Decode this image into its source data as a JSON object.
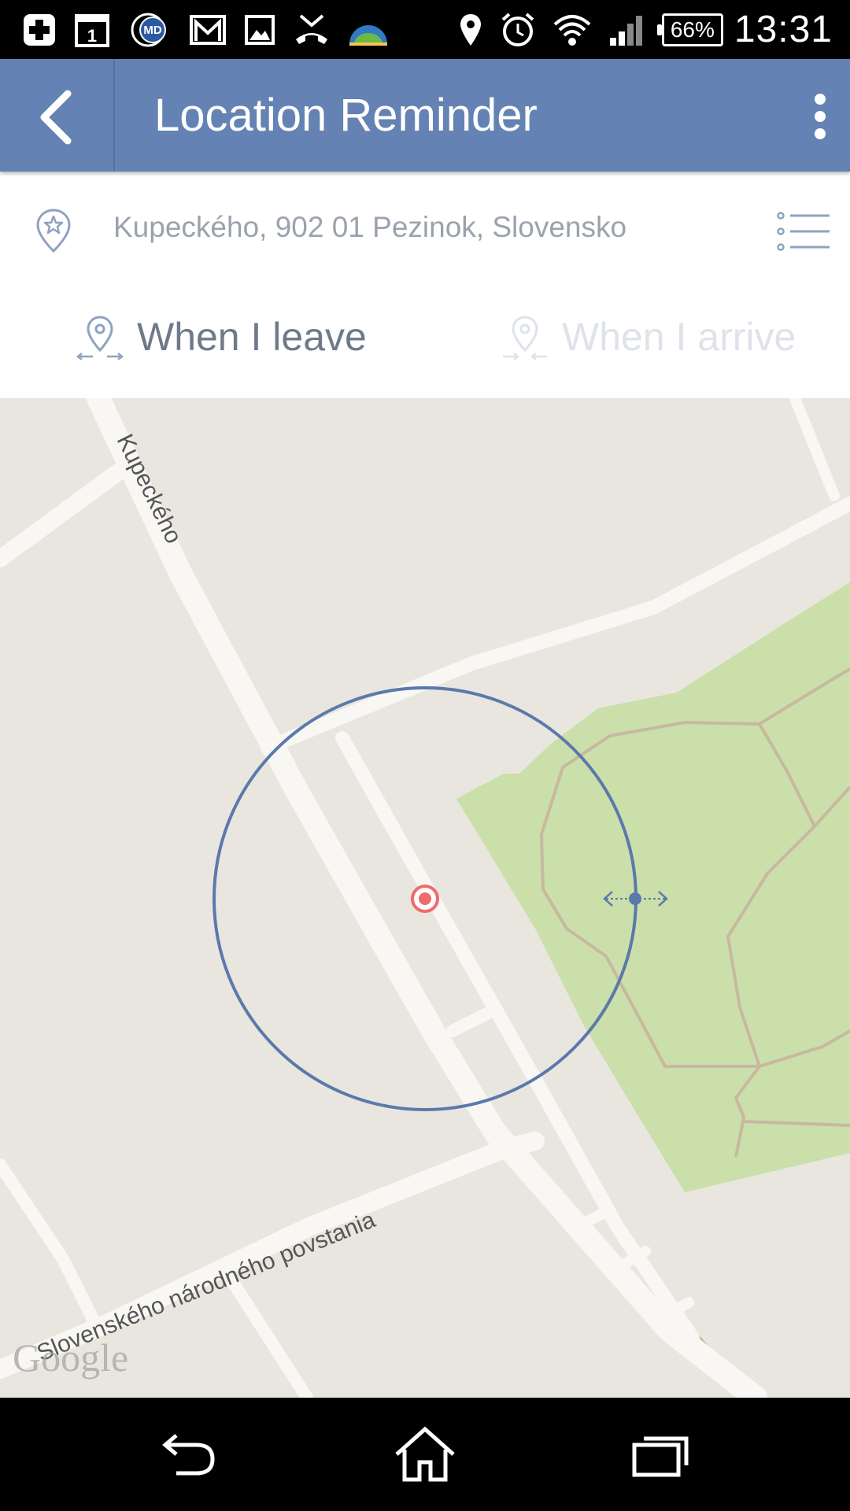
{
  "status_bar": {
    "battery": "66%",
    "time": "13:31",
    "left_icons": [
      "plus-app-icon",
      "calendar-icon",
      "md-app-icon",
      "gmail-icon",
      "gallery-icon",
      "missed-call-icon",
      "globe-app-icon"
    ],
    "calendar_day": "1",
    "right_icons": [
      "location-icon",
      "alarm-icon",
      "wifi-icon",
      "signal-icon"
    ]
  },
  "app_bar": {
    "title": "Location Reminder"
  },
  "address": {
    "value": "Kupeckého, 902 01 Pezinok, Slovensko"
  },
  "modes": {
    "leave_label": "When I leave",
    "arrive_label": "When I arrive",
    "selected": "leave"
  },
  "map": {
    "street_labels": [
      "Kupeckého",
      "Slovenského národného povstania"
    ],
    "attribution": "Google",
    "radius_color": "#5b79ab",
    "marker_color": "#f06b6b",
    "park_color": "#cadfaa"
  },
  "nav_bar": {
    "buttons": [
      "back-icon",
      "home-icon",
      "recent-apps-icon"
    ]
  }
}
